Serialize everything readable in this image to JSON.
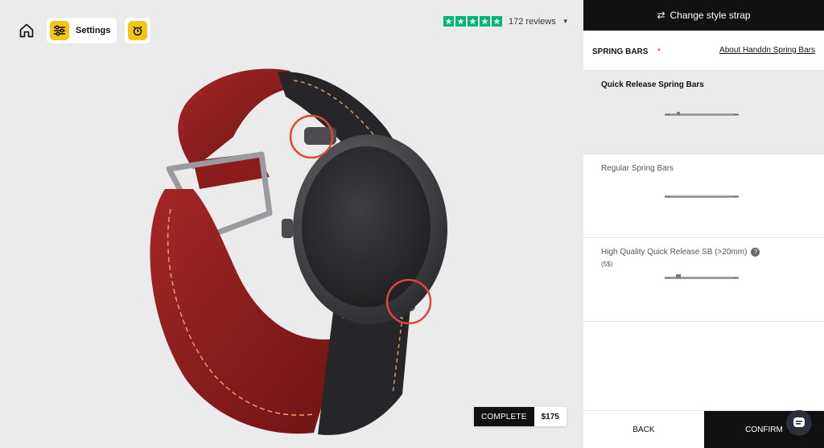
{
  "toolbar": {
    "home_icon": "home-icon",
    "settings_label": "Settings",
    "settings_icon": "sliders-icon",
    "watch_icon": "watch-icon"
  },
  "reviews": {
    "rating_stars": 5,
    "count_label": "172 reviews",
    "star_color": "#00b67a"
  },
  "price": {
    "status_label": "COMPLETE",
    "value": "$175"
  },
  "panel": {
    "header_label": "Change style strap",
    "header_icon": "swap-arrows-icon",
    "section_title": "SPRING BARS",
    "required_mark": "*",
    "about_link": "About Handdn Spring Bars",
    "options": [
      {
        "title": "Quick Release Spring Bars",
        "subtitle": "",
        "selected": true
      },
      {
        "title": "Regular Spring Bars",
        "subtitle": "",
        "selected": false
      },
      {
        "title": "High Quality Quick Release SB (>20mm)",
        "subtitle": "(5$)",
        "selected": false,
        "help": "?"
      }
    ],
    "back_label": "BACK",
    "confirm_label": "CONFIRM"
  },
  "colors": {
    "accent_yellow": "#f3c514",
    "strap_red": "#8e1c1c",
    "highlight_circle": "#e0463c",
    "dark": "#111111"
  },
  "chat": {
    "icon": "chat-icon"
  }
}
